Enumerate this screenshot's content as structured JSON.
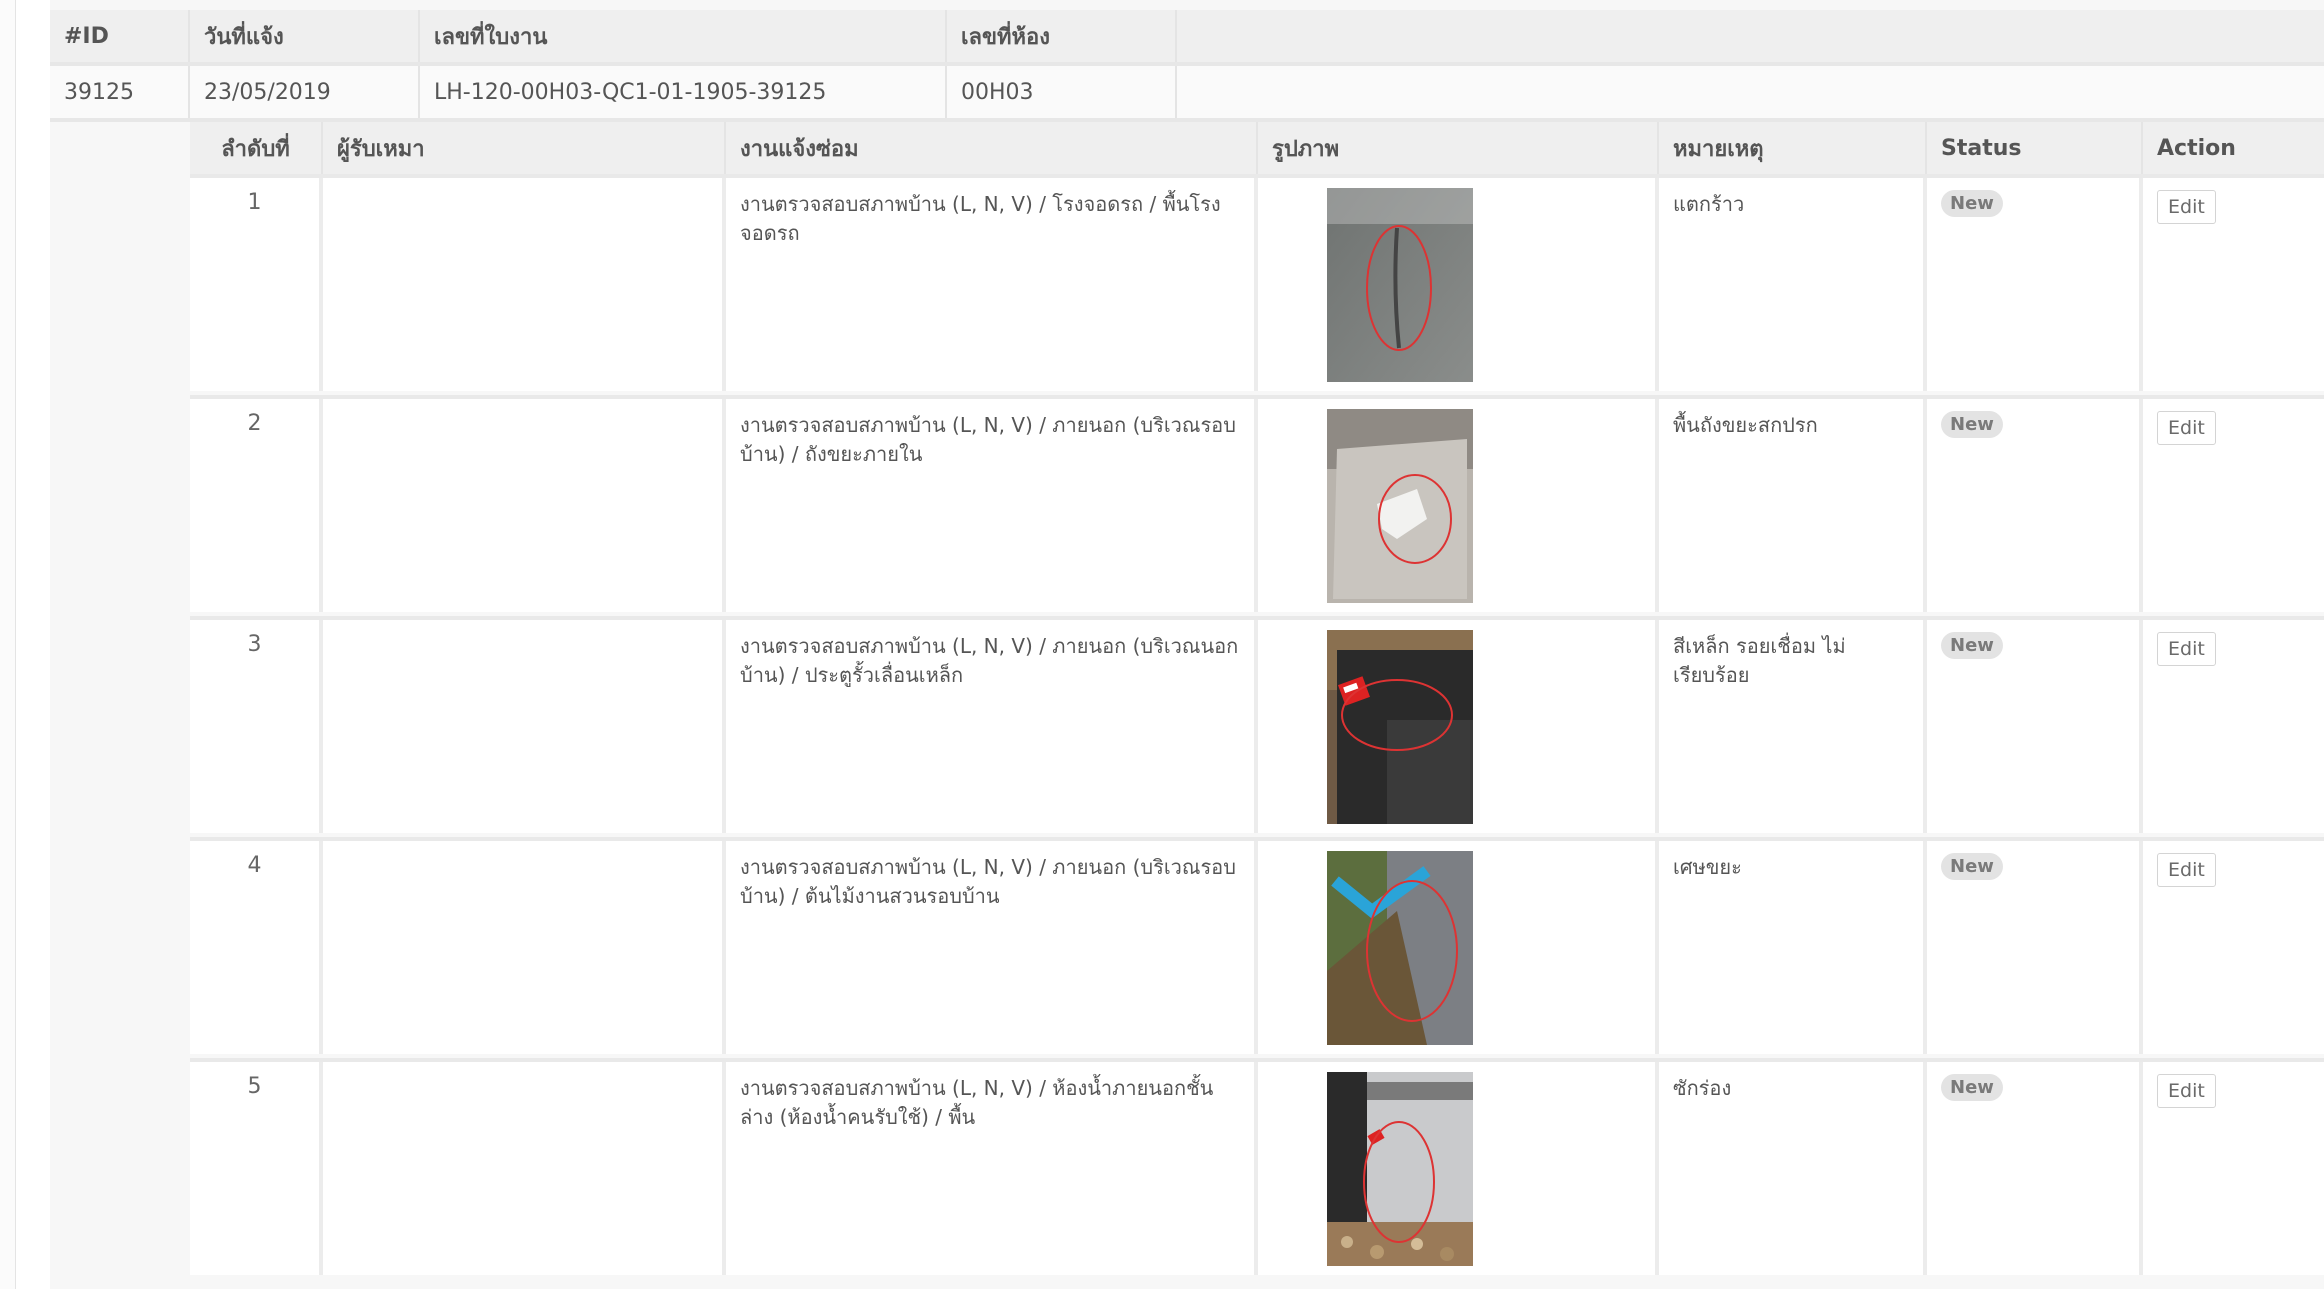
{
  "header_table": {
    "columns": [
      "#ID",
      "วันที่แจ้ง",
      "เลขที่ใบงาน",
      "เลขที่ห้อง"
    ],
    "row": {
      "id": "39125",
      "date": "23/05/2019",
      "job_no": "LH-120-00H03-QC1-01-1905-39125",
      "room_no": "00H03"
    }
  },
  "detail_table": {
    "columns": [
      "ลำดับที่",
      "ผู้รับเหมา",
      "งานแจ้งซ่อม",
      "รูปภาพ",
      "หมายเหตุ",
      "Status",
      "Action"
    ],
    "rows": [
      {
        "no": "1",
        "contractor": "",
        "work": "งานตรวจสอบสภาพบ้าน (L, N, V) / โรงจอดรถ / พื้นโรงจอดรถ",
        "note": "แตกร้าว",
        "status": "New",
        "action": "Edit",
        "photo": "concrete-floor-crack-photo"
      },
      {
        "no": "2",
        "contractor": "",
        "work": "งานตรวจสอบสภาพบ้าน (L, N, V) / ภายนอก (บริเวณรอบบ้าน) / ถังขยะภายใน",
        "note": "พื้นถังขยะสกปรก",
        "status": "New",
        "action": "Edit",
        "photo": "dirty-bin-floor-photo"
      },
      {
        "no": "3",
        "contractor": "",
        "work": "งานตรวจสอบสภาพบ้าน (L, N, V) / ภายนอก (บริเวณนอกบ้าน) / ประตูรั้วเลื่อนเหล็ก",
        "note": "สีเหล็ก รอยเชื่อม ไม่เรียบร้อย",
        "status": "New",
        "action": "Edit",
        "photo": "steel-gate-weld-photo"
      },
      {
        "no": "4",
        "contractor": "",
        "work": "งานตรวจสอบสภาพบ้าน (L, N, V) / ภายนอก (บริเวณรอบบ้าน) / ต้นไม้งานสวนรอบบ้าน",
        "note": "เศษขยะ",
        "status": "New",
        "action": "Edit",
        "photo": "garden-debris-photo"
      },
      {
        "no": "5",
        "contractor": "",
        "work": "งานตรวจสอบสภาพบ้าน (L, N, V) / ห้องน้ำภายนอกชั้นล่าง (ห้องน้ำคนรับใช้) / พื้น",
        "note": "ซักร่อง",
        "status": "New",
        "action": "Edit",
        "photo": "bathroom-floor-grout-photo"
      }
    ]
  }
}
